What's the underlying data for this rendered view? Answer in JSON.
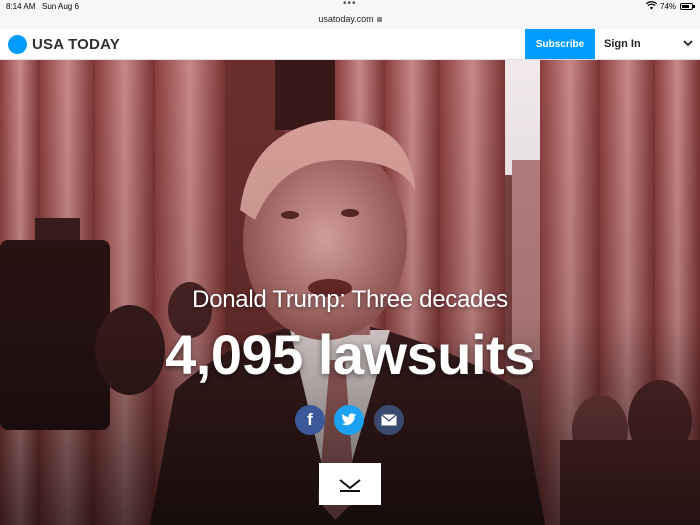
{
  "status_bar": {
    "time": "8:14 AM",
    "date": "Sun Aug 6",
    "battery_percent": "74%",
    "battery_level": 0.74
  },
  "browser": {
    "url": "usatoday.com"
  },
  "site": {
    "logo_text": "USA TODAY",
    "brand_color": "#009bff",
    "subscribe_label": "Subscribe",
    "signin_label": "Sign In"
  },
  "hero": {
    "subtitle": "Donald Trump: Three decades",
    "title": "4,095 lawsuits",
    "share": {
      "facebook_icon": "f",
      "twitter_icon": "twitter-bird-icon",
      "email_icon": "envelope-icon"
    },
    "scroll_icon": "chevron-down-icon"
  }
}
